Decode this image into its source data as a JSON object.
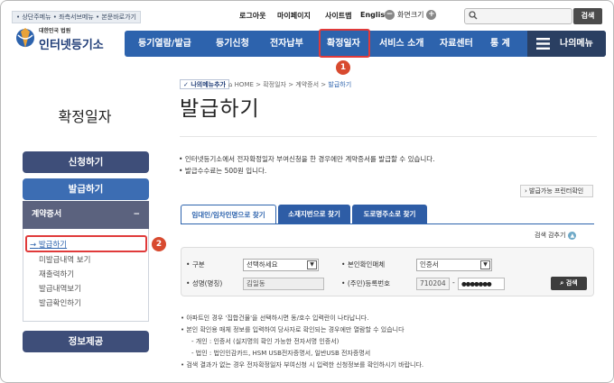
{
  "header": {
    "skip_links": "• 상단주메뉴 • 좌측서브메뉴 • 본문바로가기",
    "logout": "로그아웃",
    "mypage": "마이페이지",
    "sitemap": "사이트맵",
    "english": "English",
    "font_size_label": "화면크기",
    "font_decrease": "−",
    "font_increase": "+",
    "search_placeholder": "",
    "search_button": "검색",
    "logo_subtitle": "대한민국 법원",
    "logo_title": "인터넷등기소"
  },
  "gnb": {
    "items": [
      "등기열람/발급",
      "등기신청",
      "전자납부",
      "확정일자",
      "서비스 소개",
      "자료센터",
      "통 계"
    ],
    "my_menu": "나의메뉴"
  },
  "annotations": {
    "marker1": "1",
    "marker2": "2",
    "highlight_color": "#e03a3a"
  },
  "sidebar": {
    "title": "확정일자",
    "apply": "신청하기",
    "issue": "발급하기",
    "contract": "계약증서",
    "contract_toggle": "−",
    "sub_items": [
      "발급하기",
      "미발급내역 보기",
      "재출력하기",
      "발급내역보기",
      "발급확인하기"
    ],
    "info": "정보제공"
  },
  "breadcrumb": {
    "my_menu_add": "나의메뉴추가",
    "path": "HOME > 확정일자 > 계약증서 > ",
    "current": "발급하기"
  },
  "main": {
    "title": "발급하기",
    "bullets": [
      "인터넷등기소에서 전자확정일자 부여신청을 한 경우에만 계약증서를 발급할 수 있습니다.",
      "발급수수료는 500원 입니다."
    ],
    "printer_button": "발급가능 프린터확인",
    "tabs": [
      "임대인/임차인명으로 찾기",
      "소재지번으로 찾기",
      "도로명주소로 찾기"
    ],
    "collapse": "검색 감추기",
    "form": {
      "type_label": "구분",
      "type_value": "선택하세요",
      "verify_label": "본인확인매체",
      "verify_value": "인증서",
      "name_label": "성명(명칭)",
      "name_value": "김일동",
      "reg_label": "(주민)등록번호",
      "reg_front": "710204",
      "reg_dash": "-",
      "reg_back": "●●●●●●●",
      "find_button": "검색"
    },
    "notes": [
      "• 아파트인 경우 '집합건물'을 선택하시면 동/호수 입력란이 나타납니다.",
      "• 본인 확인용 매체 정보를 입력하여 당사자로 확인되는 경우에만 열람할 수 있습니다",
      "- 개인 : 인증서 (실지명의 확인 가능한 전자서명 인증서)",
      "- 법인 : 법인인감카드, HSM USB전자증명서, 일반USB 전자증명서",
      "• 검색 결과가 없는 경우 전자확정일자 부여신청 시 입력한 신청정보를 확인하시기 바랍니다."
    ]
  }
}
